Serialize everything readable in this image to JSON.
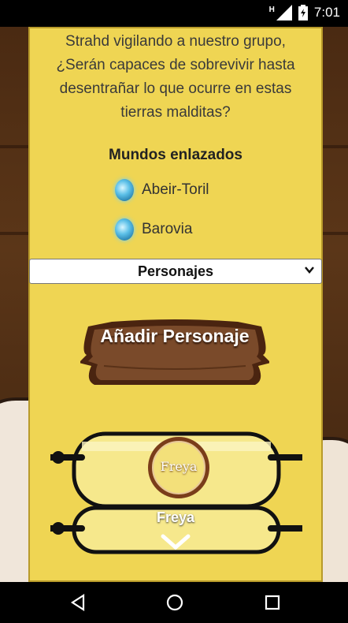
{
  "status_bar": {
    "time": "7:01",
    "network_indicator": "H",
    "icons": [
      "signal-icon",
      "battery-icon"
    ]
  },
  "description": "Strahd vigilando a nuestro grupo, ¿Serán capaces de sobrevivir hasta desentrañar lo que ocurre en estas tierras malditas?",
  "worlds": {
    "title": "Mundos enlazados",
    "items": [
      {
        "label": "Abeir-Toril",
        "icon": "blue-gem-icon"
      },
      {
        "label": "Barovia",
        "icon": "blue-gem-icon"
      }
    ]
  },
  "selector": {
    "selected": "Personajes"
  },
  "add_button": {
    "label": "Añadir Personaje"
  },
  "character_card": {
    "ring_text": "Freya",
    "name": "Freya",
    "expand_icon": "chevron-down-icon"
  },
  "nav": {
    "buttons": [
      "back-icon",
      "home-icon",
      "recents-icon"
    ]
  },
  "colors": {
    "panel": "#efd553",
    "wood": "#6b3e22",
    "gem": "#5cc0e8"
  }
}
